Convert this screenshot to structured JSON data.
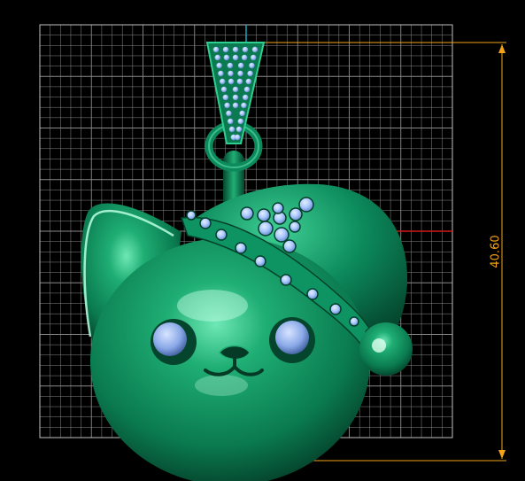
{
  "viewport": {
    "background_color": "#000000",
    "grid_color": "#8a8a8a",
    "grid_border_color": "#bfbfbf"
  },
  "model": {
    "body_color": "#0b8a5b",
    "highlight_color": "#7ff0c0",
    "gem_color": "#a9c8ff",
    "parts": [
      "cat-head",
      "left-ear",
      "santa-hat",
      "hat-pompom",
      "bail",
      "jump-ring",
      "eyes",
      "nose"
    ]
  },
  "dimension": {
    "value": "40.60",
    "line_color": "#f2a31a"
  },
  "axes": {
    "x_axis_color": "#d21818",
    "y_axis_color": "#1aa6b8"
  }
}
